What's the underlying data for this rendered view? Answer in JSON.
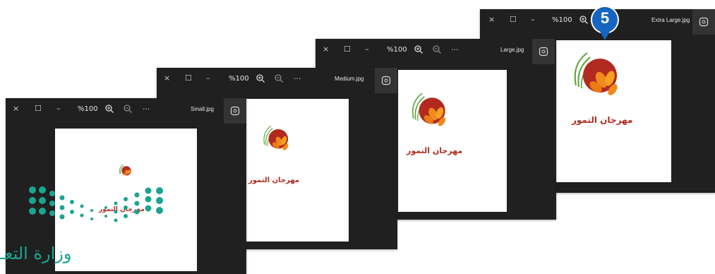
{
  "windows": [
    {
      "id": "xl",
      "file_name": "Extra Large.jpg",
      "zoom": "%100",
      "logo_text": "مهرجان التمور"
    },
    {
      "id": "lg",
      "file_name": "Large.jpg",
      "zoom": "%100",
      "logo_text": "مهرجان التمور"
    },
    {
      "id": "md",
      "file_name": "Medium.jpg",
      "zoom": "%100",
      "logo_text": "مهرجان التمور"
    },
    {
      "id": "sm",
      "file_name": "Small.jpg",
      "zoom": "%100",
      "logo_text": "مهرجان التمور"
    }
  ],
  "titlebar_icons": {
    "close": "×",
    "restore": "☐",
    "minimize": "–",
    "more": "···"
  },
  "callout": {
    "number": "5"
  },
  "watermark": {
    "text": "وزارة التعـ"
  },
  "colors": {
    "window_bg": "#202020",
    "logo_red": "#b22a1f",
    "date_orange": "#f08a1c",
    "leaf_green": "#5aa332",
    "callout_blue": "#1565c0",
    "moe_teal": "#1aa591"
  }
}
